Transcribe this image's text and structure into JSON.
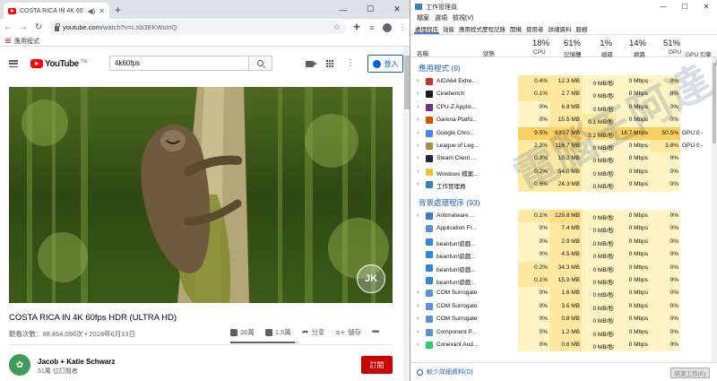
{
  "browser": {
    "tab_title": "COSTA RICA IN 4K 60fps H",
    "url_host": "youtube.com",
    "url_path": "/watch?v=LXb3EKWsInQ",
    "bookmark_apps_label": "應用程式"
  },
  "youtube": {
    "logo_text": "YouTube",
    "logo_region": "TW",
    "search_value": "4k60fps",
    "signin_label": "登入",
    "video_title": "COSTA RICA IN 4K 60fps HDR (ULTRA HD)",
    "meta": "觀看次數：88,464,096次 • 2018年6月13日",
    "likes": "26萬",
    "dislikes": "1.5萬",
    "share_label": "分享",
    "save_label": "儲存",
    "like_ratio": 0.946,
    "badge_text": "JK",
    "channel_name": "Jacob + Katie Schwarz",
    "channel_subs": "51萬 位訂閱者",
    "subscribe_label": "訂閱"
  },
  "taskmgr": {
    "title": "工作管理員",
    "menu": [
      "檔案",
      "選項",
      "檢視(V)"
    ],
    "tabs": [
      "處理程序",
      "效能",
      "應用程式歷程記錄",
      "開機",
      "使用者",
      "詳細資料",
      "服務"
    ],
    "col_name": "名稱",
    "col_status": "狀態",
    "summary": {
      "cpu": "18%",
      "memory": "61%",
      "disk": "1%",
      "network": "14%",
      "gpu": "51%"
    },
    "labels": {
      "cpu": "CPU",
      "memory": "記憶體",
      "disk": "磁碟",
      "network": "網路",
      "gpu": "GPU",
      "gpu_engine": "GPU 引擎"
    },
    "group_apps": "應用程式 (9)",
    "group_bg": "背景處理程序 (93)",
    "apps": [
      {
        "name": "AIDA64 Extre...",
        "cpu": "0.4%",
        "mem": "12.3 MB",
        "disk": "0 MB/秒",
        "net": "0 Mbps",
        "gpu": "0%",
        "eng": "",
        "icon": "#c0392b"
      },
      {
        "name": "Cinebench",
        "cpu": "0.1%",
        "mem": "2.7 MB",
        "disk": "0 MB/秒",
        "net": "0 Mbps",
        "gpu": "0%",
        "eng": "",
        "icon": "#1a1a1a"
      },
      {
        "name": "CPU-Z Applic...",
        "cpu": "0%",
        "mem": "6.8 MB",
        "disk": "0 MB/秒",
        "net": "0 Mbps",
        "gpu": "0%",
        "eng": "",
        "icon": "#7a2a8a"
      },
      {
        "name": "Garena Platfo...",
        "cpu": "0%",
        "mem": "15.5 MB",
        "disk": "0.1 MB/秒",
        "net": "0 Mbps",
        "gpu": "0%",
        "eng": "",
        "icon": "#d35400"
      },
      {
        "name": "Google Chro...",
        "cpu": "9.5%",
        "mem": "630.7 MB",
        "disk": "3.2 MB/秒",
        "net": "18.7 Mbps",
        "gpu": "50.5%",
        "eng": "GPU 0 -",
        "icon": "#4285f4"
      },
      {
        "name": "League of Leg...",
        "cpu": "2.2%",
        "mem": "116.7 MB",
        "disk": "0 MB/秒",
        "net": "0 Mbps",
        "gpu": "3.8%",
        "eng": "GPU 0 -",
        "icon": "#b08d3c"
      },
      {
        "name": "Steam Client ...",
        "cpu": "0.3%",
        "mem": "10.2 MB",
        "disk": "0 MB/秒",
        "net": "0 Mbps",
        "gpu": "0%",
        "eng": "",
        "icon": "#1b2838"
      },
      {
        "name": "Windows 檔案...",
        "cpu": "0.2%",
        "mem": "54.0 MB",
        "disk": "0 MB/秒",
        "net": "0 Mbps",
        "gpu": "0%",
        "eng": "",
        "icon": "#f2c12e"
      },
      {
        "name": "工作管理員",
        "cpu": "0.6%",
        "mem": "24.3 MB",
        "disk": "0 MB/秒",
        "net": "0 Mbps",
        "gpu": "0%",
        "eng": "",
        "icon": "#3a7ebf"
      }
    ],
    "bg": [
      {
        "name": "Antimalware ...",
        "cpu": "0.1%",
        "mem": "129.8 MB",
        "disk": "0 MB/秒",
        "net": "0 Mbps",
        "gpu": "0%",
        "icon": "#3a7ebf"
      },
      {
        "name": "Application Fr...",
        "cpu": "0%",
        "mem": "7.4 MB",
        "disk": "0 MB/秒",
        "net": "0 Mbps",
        "gpu": "0%",
        "icon": "#5b8fd6"
      },
      {
        "name": "beanfun!遊戲...",
        "cpu": "0%",
        "mem": "2.9 MB",
        "disk": "0 MB/秒",
        "net": "0 Mbps",
        "gpu": "0%",
        "icon": "#2e86de"
      },
      {
        "name": "beanfun!遊戲...",
        "cpu": "0%",
        "mem": "4.5 MB",
        "disk": "0 MB/秒",
        "net": "0 Mbps",
        "gpu": "0%",
        "icon": "#2e86de"
      },
      {
        "name": "beanfun!遊戲...",
        "cpu": "0.2%",
        "mem": "34.3 MB",
        "disk": "0 MB/秒",
        "net": "0 Mbps",
        "gpu": "0%",
        "icon": "#2e86de"
      },
      {
        "name": "beanfun!遊戲...",
        "cpu": "0.1%",
        "mem": "15.9 MB",
        "disk": "0 MB/秒",
        "net": "0 Mbps",
        "gpu": "0%",
        "icon": "#2e86de"
      },
      {
        "name": "COM Surrogate",
        "cpu": "0%",
        "mem": "1.6 MB",
        "disk": "0 MB/秒",
        "net": "0 Mbps",
        "gpu": "0%",
        "icon": "#5b8fd6"
      },
      {
        "name": "COM Surrogate",
        "cpu": "0%",
        "mem": "3.6 MB",
        "disk": "0 MB/秒",
        "net": "0 Mbps",
        "gpu": "0%",
        "icon": "#5b8fd6"
      },
      {
        "name": "COM Surrogate",
        "cpu": "0%",
        "mem": "0.8 MB",
        "disk": "0 MB/秒",
        "net": "0 Mbps",
        "gpu": "0%",
        "icon": "#5b8fd6"
      },
      {
        "name": "Component P...",
        "cpu": "0%",
        "mem": "1.2 MB",
        "disk": "0 MB/秒",
        "net": "0 Mbps",
        "gpu": "0%",
        "icon": "#5b8fd6"
      },
      {
        "name": "Conexant Aud...",
        "cpu": "0%",
        "mem": "0.6 MB",
        "disk": "0 MB/秒",
        "net": "0 Mbps",
        "gpu": "0%",
        "icon": "#2ecc71"
      }
    ],
    "fewer_details": "較少詳細資料(D)",
    "end_task": "結束工作(E)"
  },
  "watermark": "電腦王阿達 3C"
}
